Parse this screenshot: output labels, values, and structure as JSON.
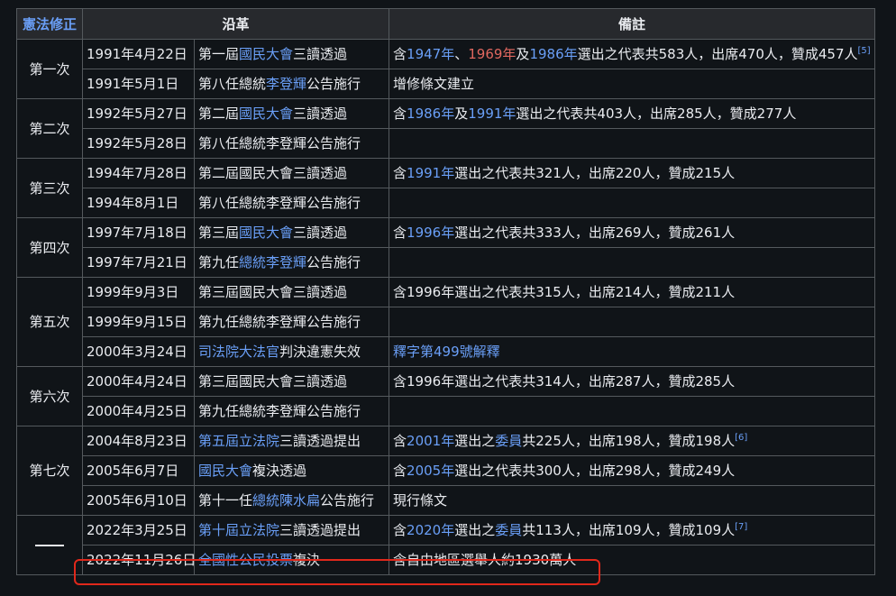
{
  "header": {
    "amend": "憲法修正",
    "history": "沿革",
    "note": "備註"
  },
  "groups": {
    "g1": {
      "label": "第一次",
      "r1": {
        "date": "1991年4月22日"
      },
      "r2": {
        "date": "1991年5月1日"
      }
    },
    "g2": {
      "label": "第二次",
      "r1": {
        "date": "1992年5月27日"
      },
      "r2": {
        "date": "1992年5月28日"
      }
    },
    "g3": {
      "label": "第三次",
      "r1": {
        "date": "1994年7月28日"
      },
      "r2": {
        "date": "1994年8月1日"
      }
    },
    "g4": {
      "label": "第四次",
      "r1": {
        "date": "1997年7月18日"
      },
      "r2": {
        "date": "1997年7月21日"
      }
    },
    "g5": {
      "label": "第五次",
      "r1": {
        "date": "1999年9月3日"
      },
      "r2": {
        "date": "1999年9月15日"
      },
      "r3": {
        "date": "2000年3月24日"
      }
    },
    "g6": {
      "label": "第六次",
      "r1": {
        "date": "2000年4月24日"
      },
      "r2": {
        "date": "2000年4月25日"
      }
    },
    "g7": {
      "label": "第七次",
      "r1": {
        "date": "2004年8月23日"
      },
      "r2": {
        "date": "2005年6月7日"
      },
      "r3": {
        "date": "2005年6月10日"
      }
    },
    "g8": {
      "r1": {
        "date": "2022年3月25日"
      },
      "r2": {
        "date": "2022年11月26日"
      }
    }
  },
  "t": {
    "dier_jie": "第二屆",
    "disan_jie": "第三屆",
    "diyi_jie": "第一屆",
    "guomindahui": "國民大會",
    "sandu_tongguo": "三讀透過",
    "diba_ren_zongtong": "第八任總統",
    "dijiu_ren": "第九任",
    "zongtong": "總統",
    "li_denghui": "李登輝",
    "gonggao_shixing": "公告施行",
    "diba_ren_full": "第八任總統李登輝公告施行",
    "dijiu_ren_full": "第九任總統李登輝公告施行",
    "disan_full": "第三屆國民大會三讀透過",
    "dier_full": "第二屆國民大會三讀透過",
    "han": "含",
    "dun": "、",
    "ji": "及",
    "y1947": "1947年",
    "y1969": "1969年",
    "y1986": "1986年",
    "y1991": "1991年",
    "y1996": "1996年",
    "y2001": "2001年",
    "y2005": "2005年",
    "y2020": "2020年",
    "n1": "選出之代表共583人，出席470人，贊成457人",
    "n1_ref": "[5]",
    "n1b": "增修條文建立",
    "n2": "選出之代表共403人，出席285人，贊成277人",
    "n3": "選出之代表共321人，出席220人，贊成215人",
    "n4": "選出之代表共333人，出席269人，贊成261人",
    "n5": "含1996年選出之代表共315人，出席214人，贊成211人",
    "sifayuan_dafaguan": "司法院大法官",
    "panjue": "判決違憲失效",
    "shizi": "釋字第499號解釋",
    "n6": "含1996年選出之代表共314人，出席287人，贊成285人",
    "diwu_jie_lifayuan": "第五屆立法院",
    "sandu_tichu": "三讀透過提出",
    "xuanchuzhi": "選出之",
    "weiyuan": "委員",
    "n7a": "共225人，出席198人，贊成198人",
    "n7a_ref": "[6]",
    "fujue_tongguo": "複決透過",
    "n7b": "選出之代表共300人，出席298人，贊成249人",
    "dishiyi_ren": "第十一任",
    "chen_shuibian": "陳水扁",
    "xianxing": "現行條文",
    "dishi_jie_lifayuan": "第十屆立法院",
    "n8a": "共113人，出席109人，贊成109人",
    "n8a_ref": "[7]",
    "quanguoxing": "全國性公民投票",
    "fujue": "複決",
    "n8b": "含自由地區選舉人約1930萬人"
  },
  "colors": {
    "link": "#6a9ff7",
    "redlink": "#e0675f",
    "highlight": "#e0281b"
  }
}
